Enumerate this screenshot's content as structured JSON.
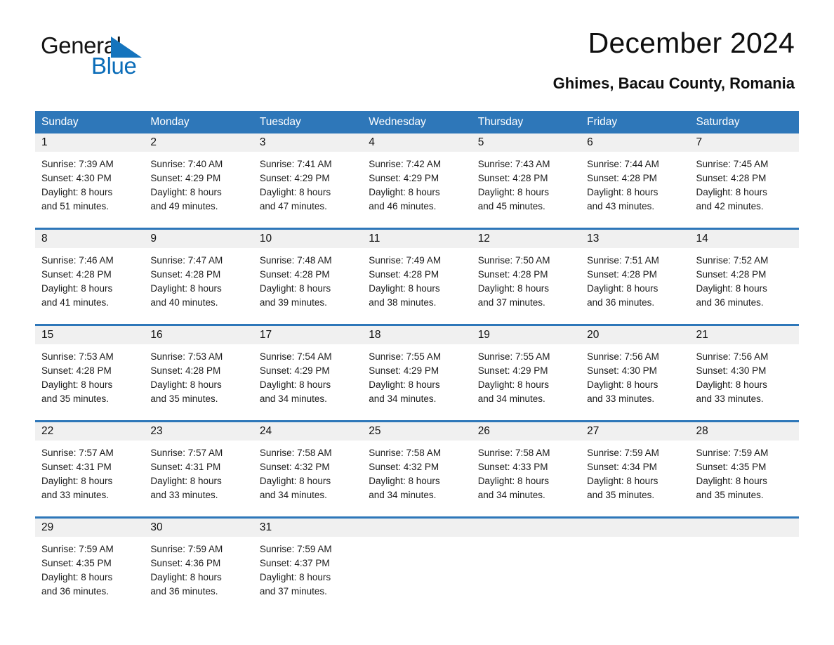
{
  "logo": {
    "word1": "General",
    "word2": "Blue",
    "triangle_color": "#1574bd",
    "blue_text_color": "#0a6cb8"
  },
  "header": {
    "title": "December 2024",
    "location": "Ghimes, Bacau County, Romania"
  },
  "theme": {
    "header_blue": "#2e77b9",
    "daynum_band": "#f0f0f0",
    "text": "#1b1b1b"
  },
  "calendar": {
    "weekdays": [
      "Sunday",
      "Monday",
      "Tuesday",
      "Wednesday",
      "Thursday",
      "Friday",
      "Saturday"
    ],
    "weeks": [
      [
        {
          "day": "1",
          "sunrise": "Sunrise: 7:39 AM",
          "sunset": "Sunset: 4:30 PM",
          "daylight1": "Daylight: 8 hours",
          "daylight2": "and 51 minutes."
        },
        {
          "day": "2",
          "sunrise": "Sunrise: 7:40 AM",
          "sunset": "Sunset: 4:29 PM",
          "daylight1": "Daylight: 8 hours",
          "daylight2": "and 49 minutes."
        },
        {
          "day": "3",
          "sunrise": "Sunrise: 7:41 AM",
          "sunset": "Sunset: 4:29 PM",
          "daylight1": "Daylight: 8 hours",
          "daylight2": "and 47 minutes."
        },
        {
          "day": "4",
          "sunrise": "Sunrise: 7:42 AM",
          "sunset": "Sunset: 4:29 PM",
          "daylight1": "Daylight: 8 hours",
          "daylight2": "and 46 minutes."
        },
        {
          "day": "5",
          "sunrise": "Sunrise: 7:43 AM",
          "sunset": "Sunset: 4:28 PM",
          "daylight1": "Daylight: 8 hours",
          "daylight2": "and 45 minutes."
        },
        {
          "day": "6",
          "sunrise": "Sunrise: 7:44 AM",
          "sunset": "Sunset: 4:28 PM",
          "daylight1": "Daylight: 8 hours",
          "daylight2": "and 43 minutes."
        },
        {
          "day": "7",
          "sunrise": "Sunrise: 7:45 AM",
          "sunset": "Sunset: 4:28 PM",
          "daylight1": "Daylight: 8 hours",
          "daylight2": "and 42 minutes."
        }
      ],
      [
        {
          "day": "8",
          "sunrise": "Sunrise: 7:46 AM",
          "sunset": "Sunset: 4:28 PM",
          "daylight1": "Daylight: 8 hours",
          "daylight2": "and 41 minutes."
        },
        {
          "day": "9",
          "sunrise": "Sunrise: 7:47 AM",
          "sunset": "Sunset: 4:28 PM",
          "daylight1": "Daylight: 8 hours",
          "daylight2": "and 40 minutes."
        },
        {
          "day": "10",
          "sunrise": "Sunrise: 7:48 AM",
          "sunset": "Sunset: 4:28 PM",
          "daylight1": "Daylight: 8 hours",
          "daylight2": "and 39 minutes."
        },
        {
          "day": "11",
          "sunrise": "Sunrise: 7:49 AM",
          "sunset": "Sunset: 4:28 PM",
          "daylight1": "Daylight: 8 hours",
          "daylight2": "and 38 minutes."
        },
        {
          "day": "12",
          "sunrise": "Sunrise: 7:50 AM",
          "sunset": "Sunset: 4:28 PM",
          "daylight1": "Daylight: 8 hours",
          "daylight2": "and 37 minutes."
        },
        {
          "day": "13",
          "sunrise": "Sunrise: 7:51 AM",
          "sunset": "Sunset: 4:28 PM",
          "daylight1": "Daylight: 8 hours",
          "daylight2": "and 36 minutes."
        },
        {
          "day": "14",
          "sunrise": "Sunrise: 7:52 AM",
          "sunset": "Sunset: 4:28 PM",
          "daylight1": "Daylight: 8 hours",
          "daylight2": "and 36 minutes."
        }
      ],
      [
        {
          "day": "15",
          "sunrise": "Sunrise: 7:53 AM",
          "sunset": "Sunset: 4:28 PM",
          "daylight1": "Daylight: 8 hours",
          "daylight2": "and 35 minutes."
        },
        {
          "day": "16",
          "sunrise": "Sunrise: 7:53 AM",
          "sunset": "Sunset: 4:28 PM",
          "daylight1": "Daylight: 8 hours",
          "daylight2": "and 35 minutes."
        },
        {
          "day": "17",
          "sunrise": "Sunrise: 7:54 AM",
          "sunset": "Sunset: 4:29 PM",
          "daylight1": "Daylight: 8 hours",
          "daylight2": "and 34 minutes."
        },
        {
          "day": "18",
          "sunrise": "Sunrise: 7:55 AM",
          "sunset": "Sunset: 4:29 PM",
          "daylight1": "Daylight: 8 hours",
          "daylight2": "and 34 minutes."
        },
        {
          "day": "19",
          "sunrise": "Sunrise: 7:55 AM",
          "sunset": "Sunset: 4:29 PM",
          "daylight1": "Daylight: 8 hours",
          "daylight2": "and 34 minutes."
        },
        {
          "day": "20",
          "sunrise": "Sunrise: 7:56 AM",
          "sunset": "Sunset: 4:30 PM",
          "daylight1": "Daylight: 8 hours",
          "daylight2": "and 33 minutes."
        },
        {
          "day": "21",
          "sunrise": "Sunrise: 7:56 AM",
          "sunset": "Sunset: 4:30 PM",
          "daylight1": "Daylight: 8 hours",
          "daylight2": "and 33 minutes."
        }
      ],
      [
        {
          "day": "22",
          "sunrise": "Sunrise: 7:57 AM",
          "sunset": "Sunset: 4:31 PM",
          "daylight1": "Daylight: 8 hours",
          "daylight2": "and 33 minutes."
        },
        {
          "day": "23",
          "sunrise": "Sunrise: 7:57 AM",
          "sunset": "Sunset: 4:31 PM",
          "daylight1": "Daylight: 8 hours",
          "daylight2": "and 33 minutes."
        },
        {
          "day": "24",
          "sunrise": "Sunrise: 7:58 AM",
          "sunset": "Sunset: 4:32 PM",
          "daylight1": "Daylight: 8 hours",
          "daylight2": "and 34 minutes."
        },
        {
          "day": "25",
          "sunrise": "Sunrise: 7:58 AM",
          "sunset": "Sunset: 4:32 PM",
          "daylight1": "Daylight: 8 hours",
          "daylight2": "and 34 minutes."
        },
        {
          "day": "26",
          "sunrise": "Sunrise: 7:58 AM",
          "sunset": "Sunset: 4:33 PM",
          "daylight1": "Daylight: 8 hours",
          "daylight2": "and 34 minutes."
        },
        {
          "day": "27",
          "sunrise": "Sunrise: 7:59 AM",
          "sunset": "Sunset: 4:34 PM",
          "daylight1": "Daylight: 8 hours",
          "daylight2": "and 35 minutes."
        },
        {
          "day": "28",
          "sunrise": "Sunrise: 7:59 AM",
          "sunset": "Sunset: 4:35 PM",
          "daylight1": "Daylight: 8 hours",
          "daylight2": "and 35 minutes."
        }
      ],
      [
        {
          "day": "29",
          "sunrise": "Sunrise: 7:59 AM",
          "sunset": "Sunset: 4:35 PM",
          "daylight1": "Daylight: 8 hours",
          "daylight2": "and 36 minutes."
        },
        {
          "day": "30",
          "sunrise": "Sunrise: 7:59 AM",
          "sunset": "Sunset: 4:36 PM",
          "daylight1": "Daylight: 8 hours",
          "daylight2": "and 36 minutes."
        },
        {
          "day": "31",
          "sunrise": "Sunrise: 7:59 AM",
          "sunset": "Sunset: 4:37 PM",
          "daylight1": "Daylight: 8 hours",
          "daylight2": "and 37 minutes."
        },
        {
          "day": "",
          "sunrise": "",
          "sunset": "",
          "daylight1": "",
          "daylight2": ""
        },
        {
          "day": "",
          "sunrise": "",
          "sunset": "",
          "daylight1": "",
          "daylight2": ""
        },
        {
          "day": "",
          "sunrise": "",
          "sunset": "",
          "daylight1": "",
          "daylight2": ""
        },
        {
          "day": "",
          "sunrise": "",
          "sunset": "",
          "daylight1": "",
          "daylight2": ""
        }
      ]
    ]
  }
}
